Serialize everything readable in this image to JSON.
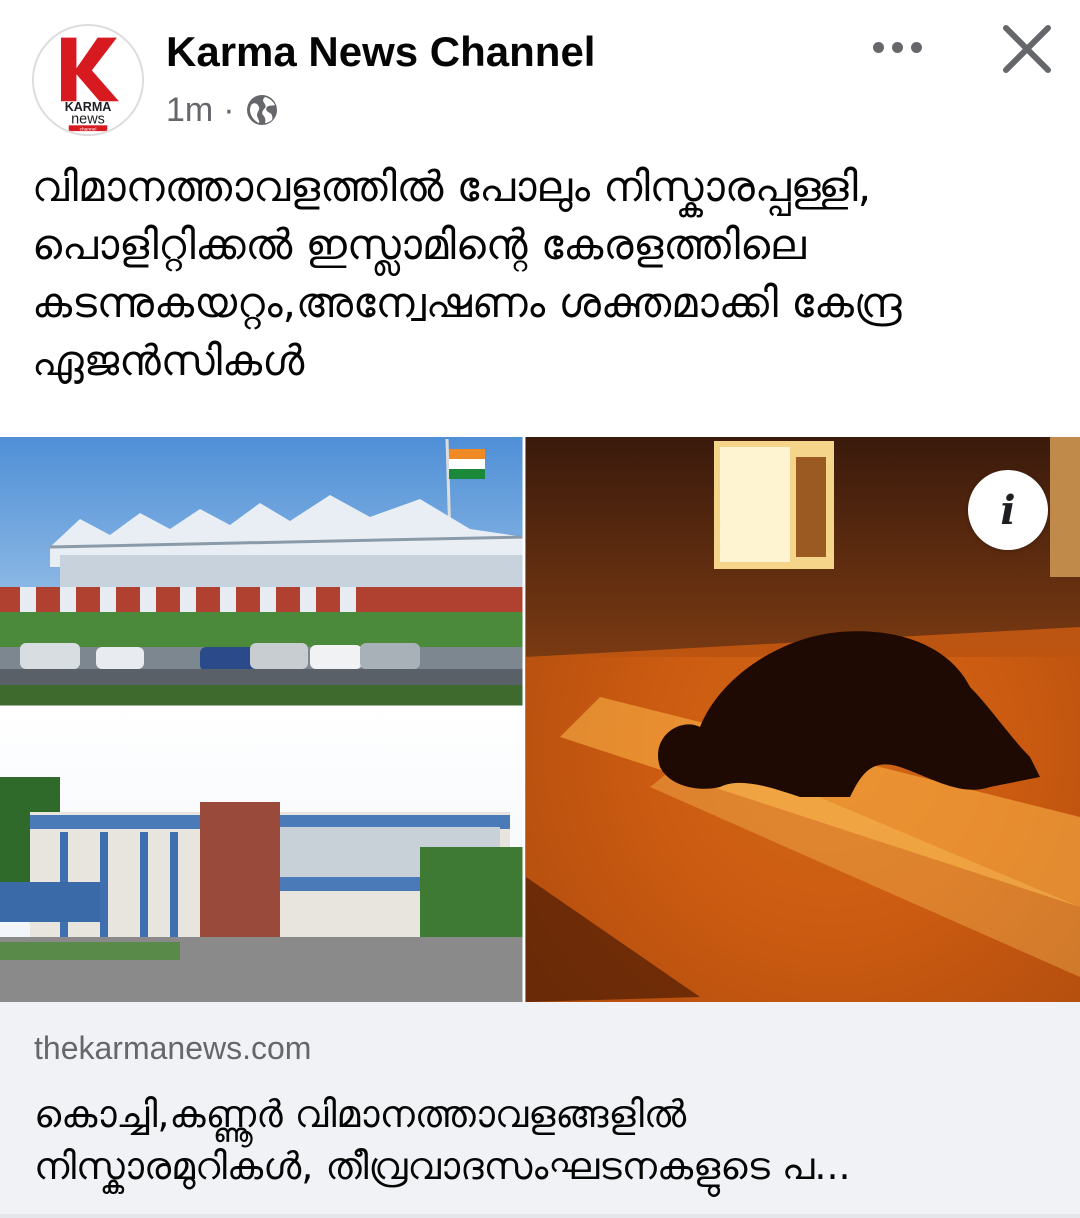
{
  "post": {
    "page_name": "Karma News Channel",
    "time": "1m",
    "separator": "·",
    "privacy_icon": "globe-icon",
    "avatar": {
      "logo_letter": "K",
      "logo_line1": "KARMA",
      "logo_line2": "news",
      "logo_line3": "channel",
      "brand_color": "#d71920"
    },
    "more_icon": "more-horizontal-icon",
    "close_icon": "close-icon",
    "text_lines": [
      "വിമാനത്താവളത്തിൽ പോലും നിസ്കാരപ്പള്ളി,",
      "പൊളിറ്റിക്കൽ ഇസ്ലാമിന്റെ കേരളത്തിലെ",
      "കടന്നുകയറ്റം,അന്വേഷണം ശക്തമാക്കി കേന്ദ്ര",
      "ഏജൻസികൾ"
    ]
  },
  "media": {
    "info_label": "i",
    "panels": [
      "airport-photo",
      "college-photo",
      "prayer-photo"
    ]
  },
  "link": {
    "domain": "thekarmanews.com",
    "title_lines": [
      "കൊച്ചി,കണ്ണൂർ വിമാനത്താവളങ്ങളിൽ",
      "നിസ്കാരമുറികൾ, തീവ്രവാദസംഘടനകളുടെ പ..."
    ]
  },
  "colors": {
    "text_primary": "#050505",
    "text_secondary": "#65676b",
    "card_bg": "#f0f2f5"
  }
}
